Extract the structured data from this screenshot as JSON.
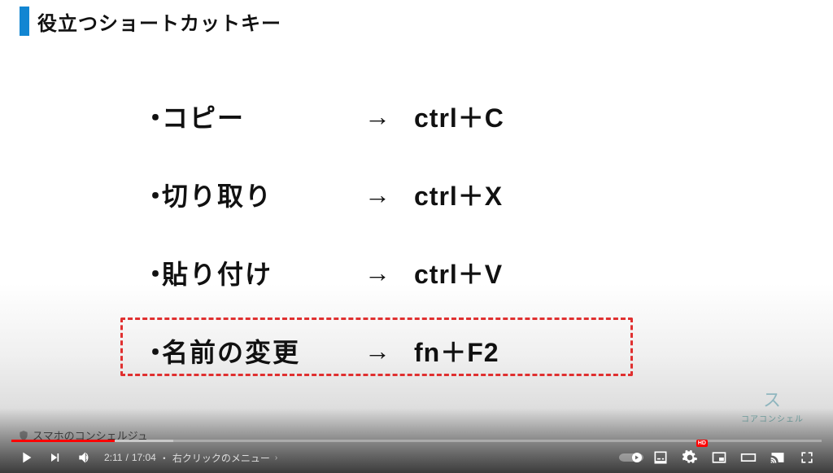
{
  "slide": {
    "title": "役立つショートカットキー",
    "rows": [
      {
        "label": "コピー",
        "arrow": "→",
        "keys": "ctrl＋C"
      },
      {
        "label": "切り取り",
        "arrow": "→",
        "keys": "ctrl＋X"
      },
      {
        "label": "貼り付け",
        "arrow": "→",
        "keys": "ctrl＋V"
      },
      {
        "label": "名前の変更",
        "arrow": "→",
        "keys": "fn＋F2"
      }
    ],
    "bullet": "・",
    "brand_left": "スマホのコンシェルジュ",
    "brand_right": "コアコンシェル"
  },
  "player": {
    "current": "2:11",
    "sep": " / ",
    "total": "17:04",
    "chapter_sep": "・",
    "chapter": "右クリックのメニュー",
    "chapter_caret": "›",
    "hd": "HD",
    "progress_played_pct": 12.8,
    "progress_loaded_pct": 20
  }
}
